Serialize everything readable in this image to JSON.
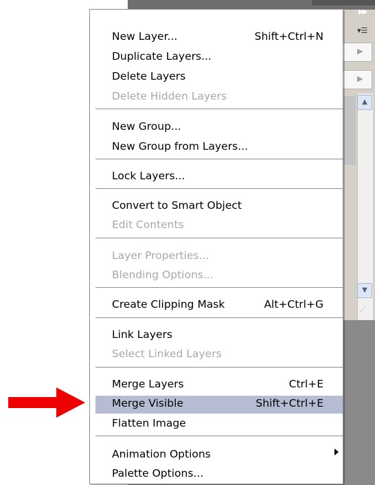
{
  "menu": {
    "items": [
      {
        "id": "new-layer",
        "label": "New Layer...",
        "shortcut": "Shift+Ctrl+N",
        "disabled": false
      },
      {
        "id": "duplicate-layers",
        "label": "Duplicate Layers...",
        "shortcut": "",
        "disabled": false
      },
      {
        "id": "delete-layers",
        "label": "Delete Layers",
        "shortcut": "",
        "disabled": false
      },
      {
        "id": "delete-hidden-layers",
        "label": "Delete Hidden Layers",
        "shortcut": "",
        "disabled": true
      },
      {
        "id": "new-group",
        "label": "New Group...",
        "shortcut": "",
        "disabled": false
      },
      {
        "id": "new-group-from-layers",
        "label": "New Group from Layers...",
        "shortcut": "",
        "disabled": false
      },
      {
        "id": "lock-layers",
        "label": "Lock Layers...",
        "shortcut": "",
        "disabled": false
      },
      {
        "id": "convert-to-smart-object",
        "label": "Convert to Smart Object",
        "shortcut": "",
        "disabled": false
      },
      {
        "id": "edit-contents",
        "label": "Edit Contents",
        "shortcut": "",
        "disabled": true
      },
      {
        "id": "layer-properties",
        "label": "Layer Properties...",
        "shortcut": "",
        "disabled": true
      },
      {
        "id": "blending-options",
        "label": "Blending Options...",
        "shortcut": "",
        "disabled": true
      },
      {
        "id": "create-clipping-mask",
        "label": "Create Clipping Mask",
        "shortcut": "Alt+Ctrl+G",
        "disabled": false
      },
      {
        "id": "link-layers",
        "label": "Link Layers",
        "shortcut": "",
        "disabled": false
      },
      {
        "id": "select-linked-layers",
        "label": "Select Linked Layers",
        "shortcut": "",
        "disabled": true
      },
      {
        "id": "merge-layers",
        "label": "Merge Layers",
        "shortcut": "Ctrl+E",
        "disabled": false
      },
      {
        "id": "merge-visible",
        "label": "Merge Visible",
        "shortcut": "Shift+Ctrl+E",
        "disabled": false,
        "highlighted": true
      },
      {
        "id": "flatten-image",
        "label": "Flatten Image",
        "shortcut": "",
        "disabled": false
      },
      {
        "id": "animation-options",
        "label": "Animation Options",
        "shortcut": "",
        "disabled": false,
        "submenu": true
      },
      {
        "id": "palette-options",
        "label": "Palette Options...",
        "shortcut": "",
        "disabled": false
      }
    ]
  },
  "colors": {
    "highlight": "#b6bdd2",
    "disabled_text": "#a8a8a8",
    "arrow": "#ee0000"
  },
  "icons": {
    "submenu": "triangle-right",
    "pointer": "red-arrow-right"
  }
}
